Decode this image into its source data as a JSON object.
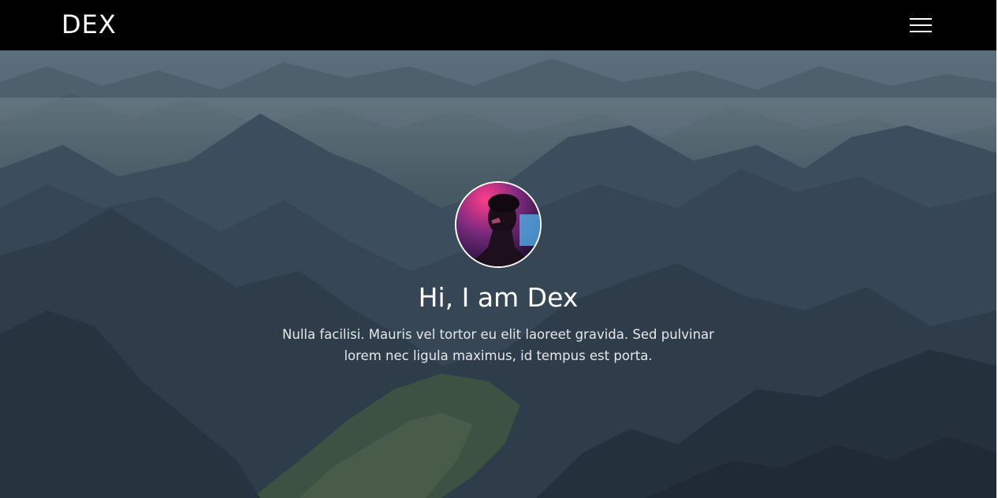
{
  "navbar": {
    "brand": "DEX",
    "menu_icon": "hamburger-menu-icon"
  },
  "hero": {
    "title": "Hi, I am Dex",
    "description": "Nulla facilisi. Mauris vel tortor eu elit laoreet gravida. Sed pulvinar lorem nec ligula maximus, id tempus est porta.",
    "avatar_icon": "profile-avatar"
  },
  "colors": {
    "navbar_bg": "#000000",
    "hero_text": "#ffffff",
    "avatar_border": "#ffffff",
    "avatar_accent": "#e03a7a"
  }
}
